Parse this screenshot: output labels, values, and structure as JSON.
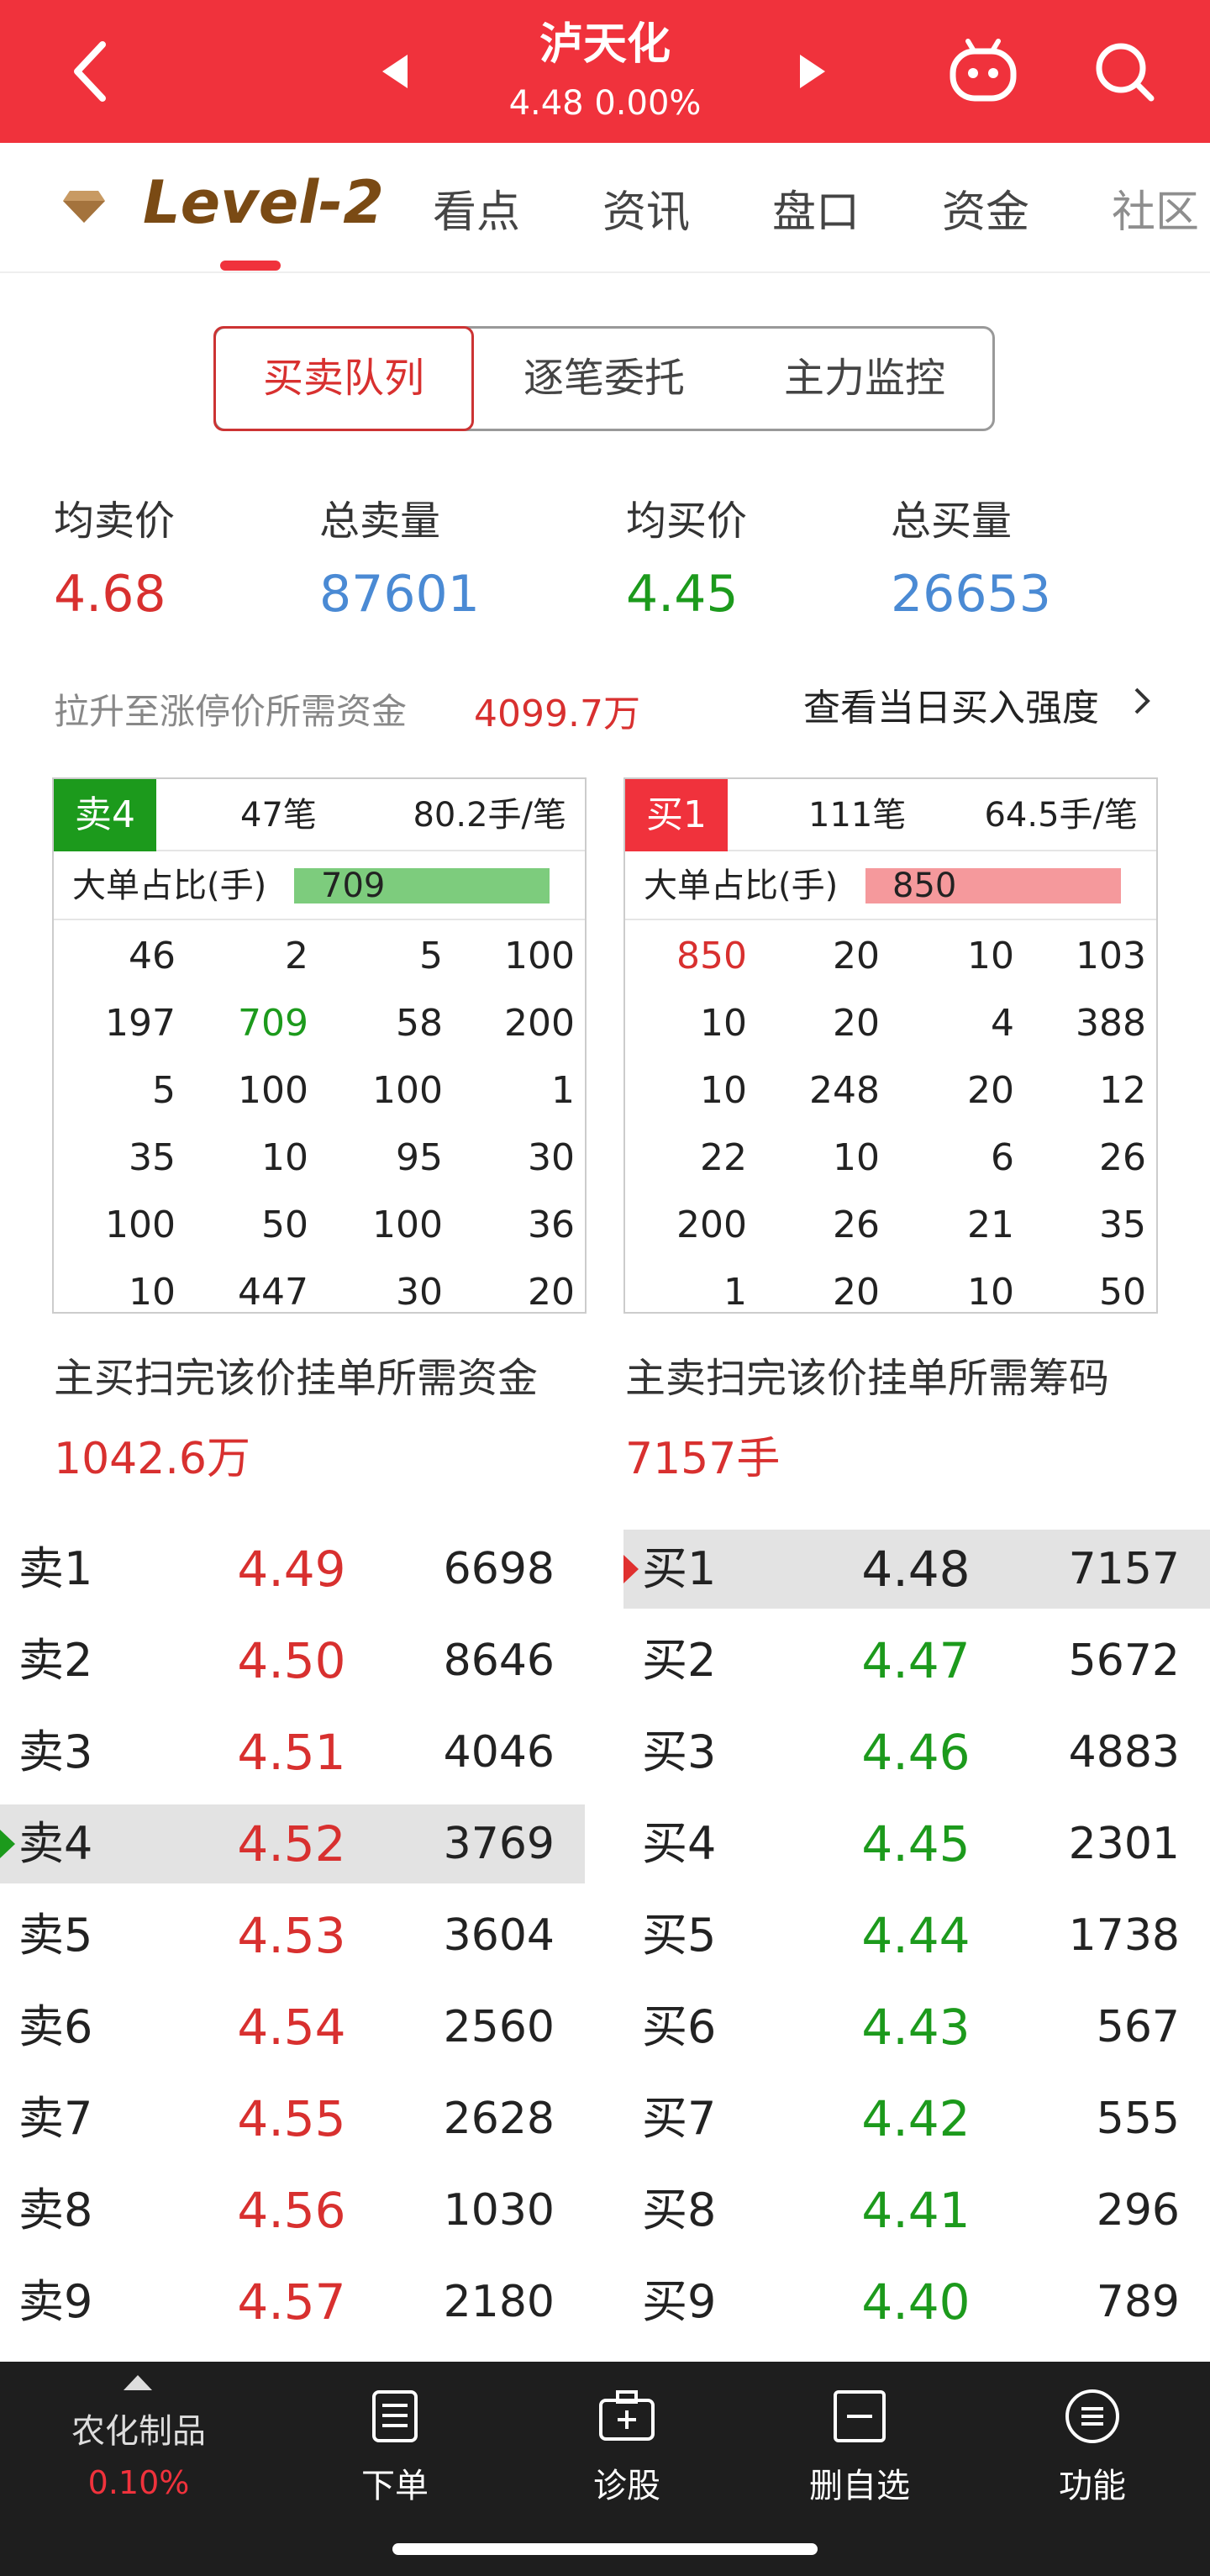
{
  "header": {
    "title": "泸天化",
    "price_change": "4.48 0.00%"
  },
  "tabs": [
    "看点",
    "资讯",
    "盘口",
    "资金",
    "社区"
  ],
  "level2_label": "Level-2",
  "segments": [
    "买卖队列",
    "逐笔委托",
    "主力监控"
  ],
  "stats": {
    "avg_sell_label": "均卖价",
    "avg_sell": "4.68",
    "total_sell_label": "总卖量",
    "total_sell": "87601",
    "avg_buy_label": "均买价",
    "avg_buy": "4.45",
    "total_buy_label": "总买量",
    "total_buy": "26653"
  },
  "limit": {
    "label": "拉升至涨停价所需资金",
    "value": "4099.7万",
    "link": "查看当日买入强度"
  },
  "sell_box": {
    "badge": "卖4",
    "count": "47笔",
    "avg": "80.2手/笔",
    "ratio_label": "大单占比(手)",
    "ratio_value": "709",
    "ratio_fraction": 0.92,
    "rows": [
      [
        "46",
        "2",
        "5",
        "100"
      ],
      [
        "197",
        "709",
        "58",
        "200"
      ],
      [
        "5",
        "100",
        "100",
        "1"
      ],
      [
        "35",
        "10",
        "95",
        "30"
      ],
      [
        "100",
        "50",
        "100",
        "36"
      ],
      [
        "10",
        "447",
        "30",
        "20"
      ]
    ]
  },
  "buy_box": {
    "badge": "买1",
    "count": "111笔",
    "avg": "64.5手/笔",
    "ratio_label": "大单占比(手)",
    "ratio_value": "850",
    "ratio_fraction": 0.92,
    "rows": [
      [
        "850",
        "20",
        "10",
        "103"
      ],
      [
        "10",
        "20",
        "4",
        "388"
      ],
      [
        "10",
        "248",
        "20",
        "12"
      ],
      [
        "22",
        "10",
        "6",
        "26"
      ],
      [
        "200",
        "26",
        "21",
        "35"
      ],
      [
        "1",
        "20",
        "10",
        "50"
      ]
    ]
  },
  "sweep": {
    "buy_label": "主买扫完该价挂单所需资金",
    "buy_value": "1042.6万",
    "sell_label": "主卖扫完该价挂单所需筹码",
    "sell_value": "7157手"
  },
  "sell_levels": [
    {
      "name": "卖1",
      "price": "4.49",
      "vol": "6698"
    },
    {
      "name": "卖2",
      "price": "4.50",
      "vol": "8646"
    },
    {
      "name": "卖3",
      "price": "4.51",
      "vol": "4046"
    },
    {
      "name": "卖4",
      "price": "4.52",
      "vol": "3769"
    },
    {
      "name": "卖5",
      "price": "4.53",
      "vol": "3604"
    },
    {
      "name": "卖6",
      "price": "4.54",
      "vol": "2560"
    },
    {
      "name": "卖7",
      "price": "4.55",
      "vol": "2628"
    },
    {
      "name": "卖8",
      "price": "4.56",
      "vol": "1030"
    },
    {
      "name": "卖9",
      "price": "4.57",
      "vol": "2180"
    }
  ],
  "buy_levels": [
    {
      "name": "买1",
      "price": "4.48",
      "vol": "7157"
    },
    {
      "name": "买2",
      "price": "4.47",
      "vol": "5672"
    },
    {
      "name": "买3",
      "price": "4.46",
      "vol": "4883"
    },
    {
      "name": "买4",
      "price": "4.45",
      "vol": "2301"
    },
    {
      "name": "买5",
      "price": "4.44",
      "vol": "1738"
    },
    {
      "name": "买6",
      "price": "4.43",
      "vol": "567"
    },
    {
      "name": "买7",
      "price": "4.42",
      "vol": "555"
    },
    {
      "name": "买8",
      "price": "4.41",
      "vol": "296"
    },
    {
      "name": "买9",
      "price": "4.40",
      "vol": "789"
    }
  ],
  "footer": {
    "sector": "农化制品",
    "sector_change": "0.10%",
    "items": [
      "下单",
      "诊股",
      "删自选",
      "功能"
    ]
  },
  "colors": {
    "brand": "#f0323c",
    "up": "#d8302f",
    "down": "#1c9a1c",
    "blue": "#4a8ad4",
    "footer_bg": "#1e1e1e"
  }
}
